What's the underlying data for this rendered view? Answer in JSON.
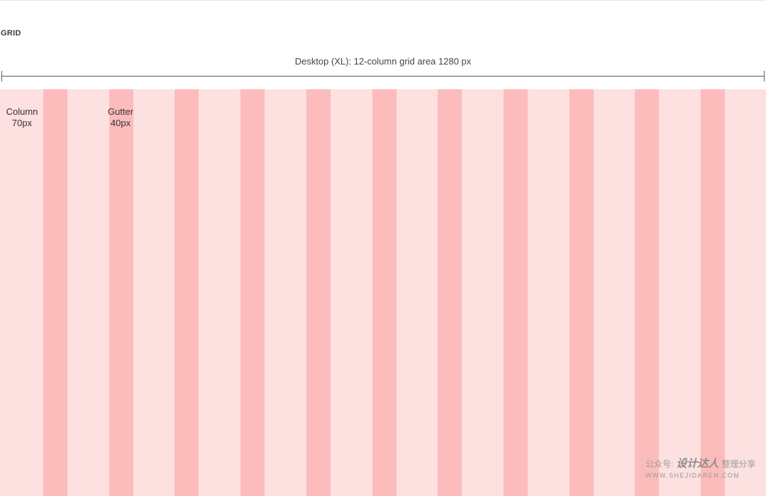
{
  "section_heading": "GRID",
  "measure": {
    "label": "Desktop (XL): 12-column grid area 1280 px"
  },
  "grid": {
    "column_count": 12,
    "column_note": {
      "title": "Column",
      "value": "70px"
    },
    "gutter_note": {
      "title": "Gutter",
      "value": "40px"
    }
  },
  "watermark": {
    "prefix": "公众号:",
    "brand": "设计达人",
    "suffix": "整理分享",
    "url": "WWW.SHEJIDAREN.COM"
  },
  "colors": {
    "column": "#fde0e0",
    "gutter": "#fdbcbc",
    "rule": "#5a5a5a"
  }
}
